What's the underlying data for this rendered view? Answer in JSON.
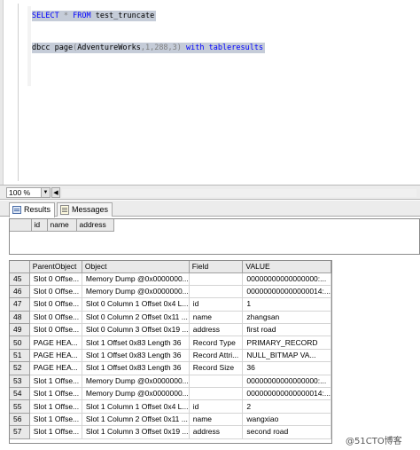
{
  "editor": {
    "line1": {
      "kw1": "SELECT",
      "star": "*",
      "kw2": "FROM",
      "table": "test_truncate"
    },
    "line2": {
      "cmd": "dbcc page",
      "open": "(",
      "db": "AdventureWorks",
      "args": ",1,288,3",
      "close": ")",
      "with": "with",
      "opt": "tableresults"
    }
  },
  "zoom": {
    "value": "100 %"
  },
  "tabs": [
    {
      "label": "Results",
      "icon": "grid-icon",
      "active": true
    },
    {
      "label": "Messages",
      "icon": "message-icon",
      "active": false
    }
  ],
  "grid1": {
    "columns": [
      "id",
      "name",
      "address"
    ]
  },
  "grid2": {
    "columns": [
      "ParentObject",
      "Object",
      "Field",
      "VALUE"
    ],
    "rows": [
      {
        "n": "45",
        "parent": "Slot 0 Offse...",
        "object": "Memory Dump @0x0000000...",
        "field": "",
        "value": "00000000000000000:..."
      },
      {
        "n": "46",
        "parent": "Slot 0 Offse...",
        "object": "Memory Dump @0x0000000...",
        "field": "",
        "value": "000000000000000014:..."
      },
      {
        "n": "47",
        "parent": "Slot 0 Offse...",
        "object": "Slot 0 Column 1 Offset 0x4 L...",
        "field": "id",
        "value": "1"
      },
      {
        "n": "48",
        "parent": "Slot 0 Offse...",
        "object": "Slot 0 Column 2 Offset 0x11 ...",
        "field": "name",
        "value": "zhangsan"
      },
      {
        "n": "49",
        "parent": "Slot 0 Offse...",
        "object": "Slot 0 Column 3 Offset 0x19 ...",
        "field": "address",
        "value": "first road"
      },
      {
        "n": "50",
        "parent": "PAGE HEA...",
        "object": "Slot 1 Offset 0x83 Length 36",
        "field": "Record Type",
        "value": "PRIMARY_RECORD"
      },
      {
        "n": "51",
        "parent": "PAGE HEA...",
        "object": "Slot 1 Offset 0x83 Length 36",
        "field": "Record Attri...",
        "value": "NULL_BITMAP VA..."
      },
      {
        "n": "52",
        "parent": "PAGE HEA...",
        "object": "Slot 1 Offset 0x83 Length 36",
        "field": "Record Size",
        "value": "36"
      },
      {
        "n": "53",
        "parent": "Slot 1 Offse...",
        "object": "Memory Dump @0x0000000...",
        "field": "",
        "value": "00000000000000000:..."
      },
      {
        "n": "54",
        "parent": "Slot 1 Offse...",
        "object": "Memory Dump @0x0000000...",
        "field": "",
        "value": "000000000000000014:..."
      },
      {
        "n": "55",
        "parent": "Slot 1 Offse...",
        "object": "Slot 1 Column 1 Offset 0x4 L...",
        "field": "id",
        "value": "2"
      },
      {
        "n": "56",
        "parent": "Slot 1 Offse...",
        "object": "Slot 1 Column 2 Offset 0x11 ...",
        "field": "name",
        "value": "wangxiao"
      },
      {
        "n": "57",
        "parent": "Slot 1 Offse...",
        "object": "Slot 1 Column 3 Offset 0x19 ...",
        "field": "address",
        "value": "second road"
      }
    ]
  },
  "watermark": "@51CTO博客"
}
